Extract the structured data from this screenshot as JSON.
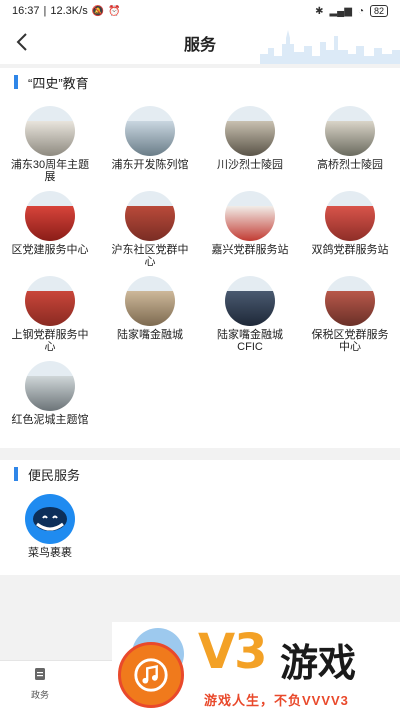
{
  "status": {
    "time": "16:37",
    "speed": "12.3K/s",
    "battery": "82"
  },
  "navbar": {
    "title": "服务"
  },
  "section1": {
    "title": "“四史”教育",
    "items": [
      {
        "label": "浦东30周年主题展",
        "colors": [
          "#e8e4dc",
          "#8e8a80"
        ]
      },
      {
        "label": "浦东开发陈列馆",
        "colors": [
          "#c9d6e0",
          "#6a7d88"
        ]
      },
      {
        "label": "川沙烈士陵园",
        "colors": [
          "#c8c0b0",
          "#5a5448"
        ]
      },
      {
        "label": "高桥烈士陵园",
        "colors": [
          "#d9d4c8",
          "#6a6a5e"
        ]
      },
      {
        "label": "区党建服务中心",
        "colors": [
          "#d7443a",
          "#8a1d18"
        ]
      },
      {
        "label": "沪东社区党群中心",
        "colors": [
          "#b94a3a",
          "#7a2d24"
        ]
      },
      {
        "label": "嘉兴党群服务站",
        "colors": [
          "#f1ede8",
          "#c23b33"
        ]
      },
      {
        "label": "双鸽党群服务站",
        "colors": [
          "#d8544a",
          "#8e2e28"
        ]
      },
      {
        "label": "上钢党群服务中心",
        "colors": [
          "#c9463a",
          "#8a2a22"
        ]
      },
      {
        "label": "陆家嘴金融城",
        "colors": [
          "#cdb89a",
          "#7d6a50"
        ]
      },
      {
        "label": "陆家嘴金融城CFIC",
        "colors": [
          "#4a5a70",
          "#1e2838"
        ]
      },
      {
        "label": "保税区党群服务中心",
        "colors": [
          "#b8584a",
          "#6a3028"
        ]
      },
      {
        "label": "红色泥城主题馆",
        "colors": [
          "#cfd6d8",
          "#6c7478"
        ]
      }
    ]
  },
  "section2": {
    "title": "便民服务",
    "items": [
      {
        "label": "菜鸟裹裹"
      }
    ]
  },
  "footer": {
    "tab1": "政务"
  },
  "ad": {
    "brand": "V3",
    "name": "游戏",
    "slogan": "游戏人生，不负VVVV3"
  }
}
